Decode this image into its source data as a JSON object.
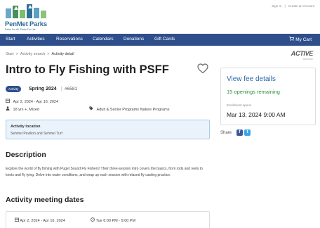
{
  "brand": {
    "name": "PenMet Parks",
    "tagline": "Parks For All. Parks For Life."
  },
  "top_links": {
    "sign_in": "Sign In",
    "separator": "|",
    "create_account": "Create an Account"
  },
  "nav": {
    "items": [
      "Start",
      "Activities",
      "Reservations",
      "Calendars",
      "Donations",
      "Gift Cards"
    ],
    "cart": "My Cart"
  },
  "breadcrumb": {
    "items": [
      "Start",
      "Activity search",
      "Activity detail"
    ],
    "separator": ">"
  },
  "active_logo": {
    "text": "ACTIVE",
    "sub": "NETWORK"
  },
  "activity": {
    "title": "Intro to Fly Fishing with PSFF",
    "badge": "Activity",
    "season": "Spring 2024",
    "divider": "|",
    "code": "#6581",
    "date_range": "Apr 2, 2024 - Apr 16, 2024",
    "age": "18 yrs +, Mixed",
    "categories": "Adult & Senior Programs  Nature Programs",
    "location_label": "Activity location",
    "location_value": "Sehmel Pavilion and Sehmel Turf",
    "description_heading": "Description",
    "description": "Explore the world of fly fishing with Puget Sound Fly Fishers! Their three-session intro covers the basics, from rods and reels to knots and fly tying. Delve into water conditions, and wrap up each session with relaxed fly casting practice.",
    "meeting_heading": "Activity meeting dates",
    "meeting_range": "Apr 2, 2024 - Apr 16, 2024",
    "meeting_time": "Tue 6:00 PM - 9:00 PM"
  },
  "fee_card": {
    "link": "View fee details",
    "openings": "15 openings remaining",
    "enroll_label": "Enrollment opens",
    "enroll_date": "Mar 13, 2024 9:00 AM"
  },
  "share": {
    "label": "Share",
    "facebook": "f",
    "twitter": "t"
  },
  "icons": {
    "calendar": "calendar-icon",
    "person": "person-icon",
    "tag": "tag-icon",
    "clock": "clock-icon",
    "heart": "heart-icon",
    "cart": "cart-icon"
  },
  "colors": {
    "nav_bg": "#2f4f8c",
    "link": "#2d67a8",
    "openings": "#2f8f3e",
    "location_bg": "#eaf3fb"
  }
}
